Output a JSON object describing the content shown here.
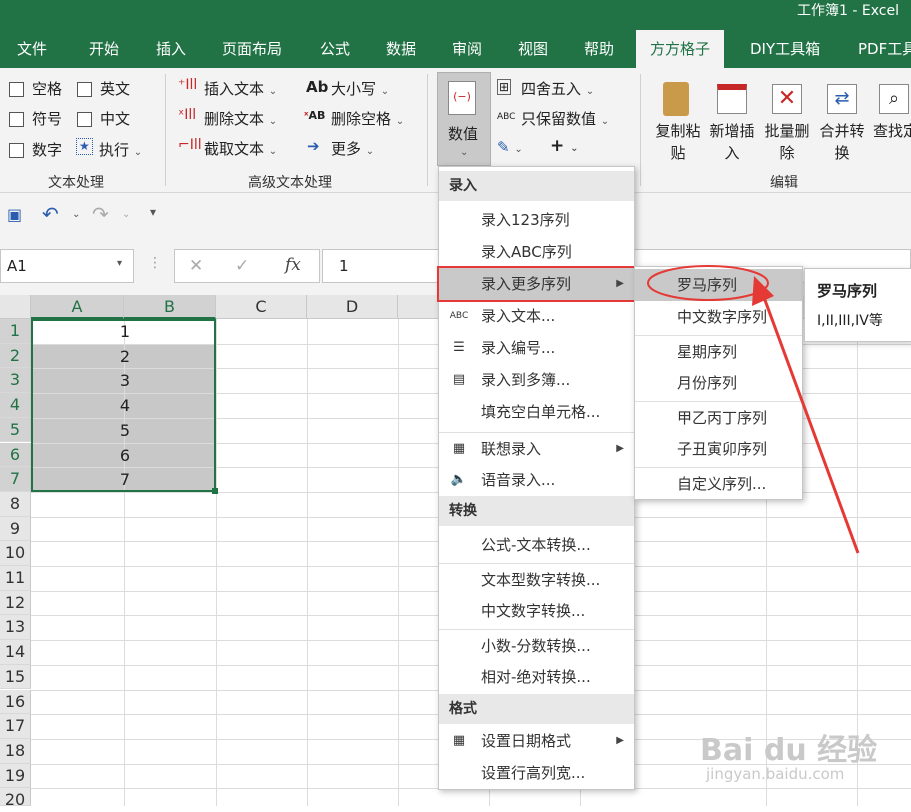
{
  "title": "工作簿1 - Excel",
  "tabs": [
    "文件",
    "开始",
    "插入",
    "页面布局",
    "公式",
    "数据",
    "审阅",
    "视图",
    "帮助",
    "方方格子",
    "DIY工具箱",
    "PDF工具"
  ],
  "active_tab": "方方格子",
  "ribbon": {
    "text_group": {
      "label": "文本处理",
      "items": [
        "空格",
        "英文",
        "符号",
        "中文",
        "数字",
        "执行"
      ]
    },
    "adv_group": {
      "label": "高级文本处理",
      "items": [
        "插入文本",
        "删除文本",
        "截取文本",
        "大小写",
        "删除空格",
        "更多"
      ]
    },
    "value_group": {
      "button": "数值",
      "items": [
        "四舍五入",
        "只保留数值"
      ]
    },
    "edit_group": {
      "label": "编辑",
      "buttons": [
        "复制粘贴",
        "新增插入",
        "批量删除",
        "合并转换",
        "查找定位"
      ]
    }
  },
  "namebox": "A1",
  "formula_value": "1",
  "formula_fx": "fx",
  "columns": [
    "A",
    "B",
    "C",
    "D"
  ],
  "rows": [
    "1",
    "2",
    "3",
    "4",
    "5",
    "6",
    "7",
    "8",
    "9",
    "10",
    "11",
    "12",
    "13",
    "14",
    "15",
    "16",
    "17",
    "18",
    "19",
    "20"
  ],
  "cells_a": [
    "1",
    "2",
    "3",
    "4",
    "5",
    "6",
    "7"
  ],
  "menu": {
    "sections": [
      {
        "header": "录入",
        "items": [
          "录入123序列",
          "录入ABC序列",
          "录入更多序列",
          "录入文本...",
          "录入编号...",
          "录入到多簿...",
          "填充空白单元格...",
          "联想录入",
          "语音录入..."
        ]
      },
      {
        "header": "转换",
        "items": [
          "公式-文本转换...",
          "文本型数字转换...",
          "中文数字转换...",
          "小数-分数转换...",
          "相对-绝对转换..."
        ]
      },
      {
        "header": "格式",
        "items": [
          "设置日期格式",
          "设置行高列宽..."
        ]
      }
    ]
  },
  "submenu": [
    "罗马序列",
    "中文数字序列",
    "星期序列",
    "月份序列",
    "甲乙丙丁序列",
    "子丑寅卯序列",
    "自定义序列..."
  ],
  "tooltip": {
    "title": "罗马序列",
    "body": "I,II,III,IV等"
  },
  "watermark": {
    "brand": "Bai du 经验",
    "url": "jingyan.baidu.com"
  },
  "colors": {
    "excel_green": "#217346",
    "highlight_red": "#e53935",
    "selection_gray": "#c8c8c8"
  }
}
